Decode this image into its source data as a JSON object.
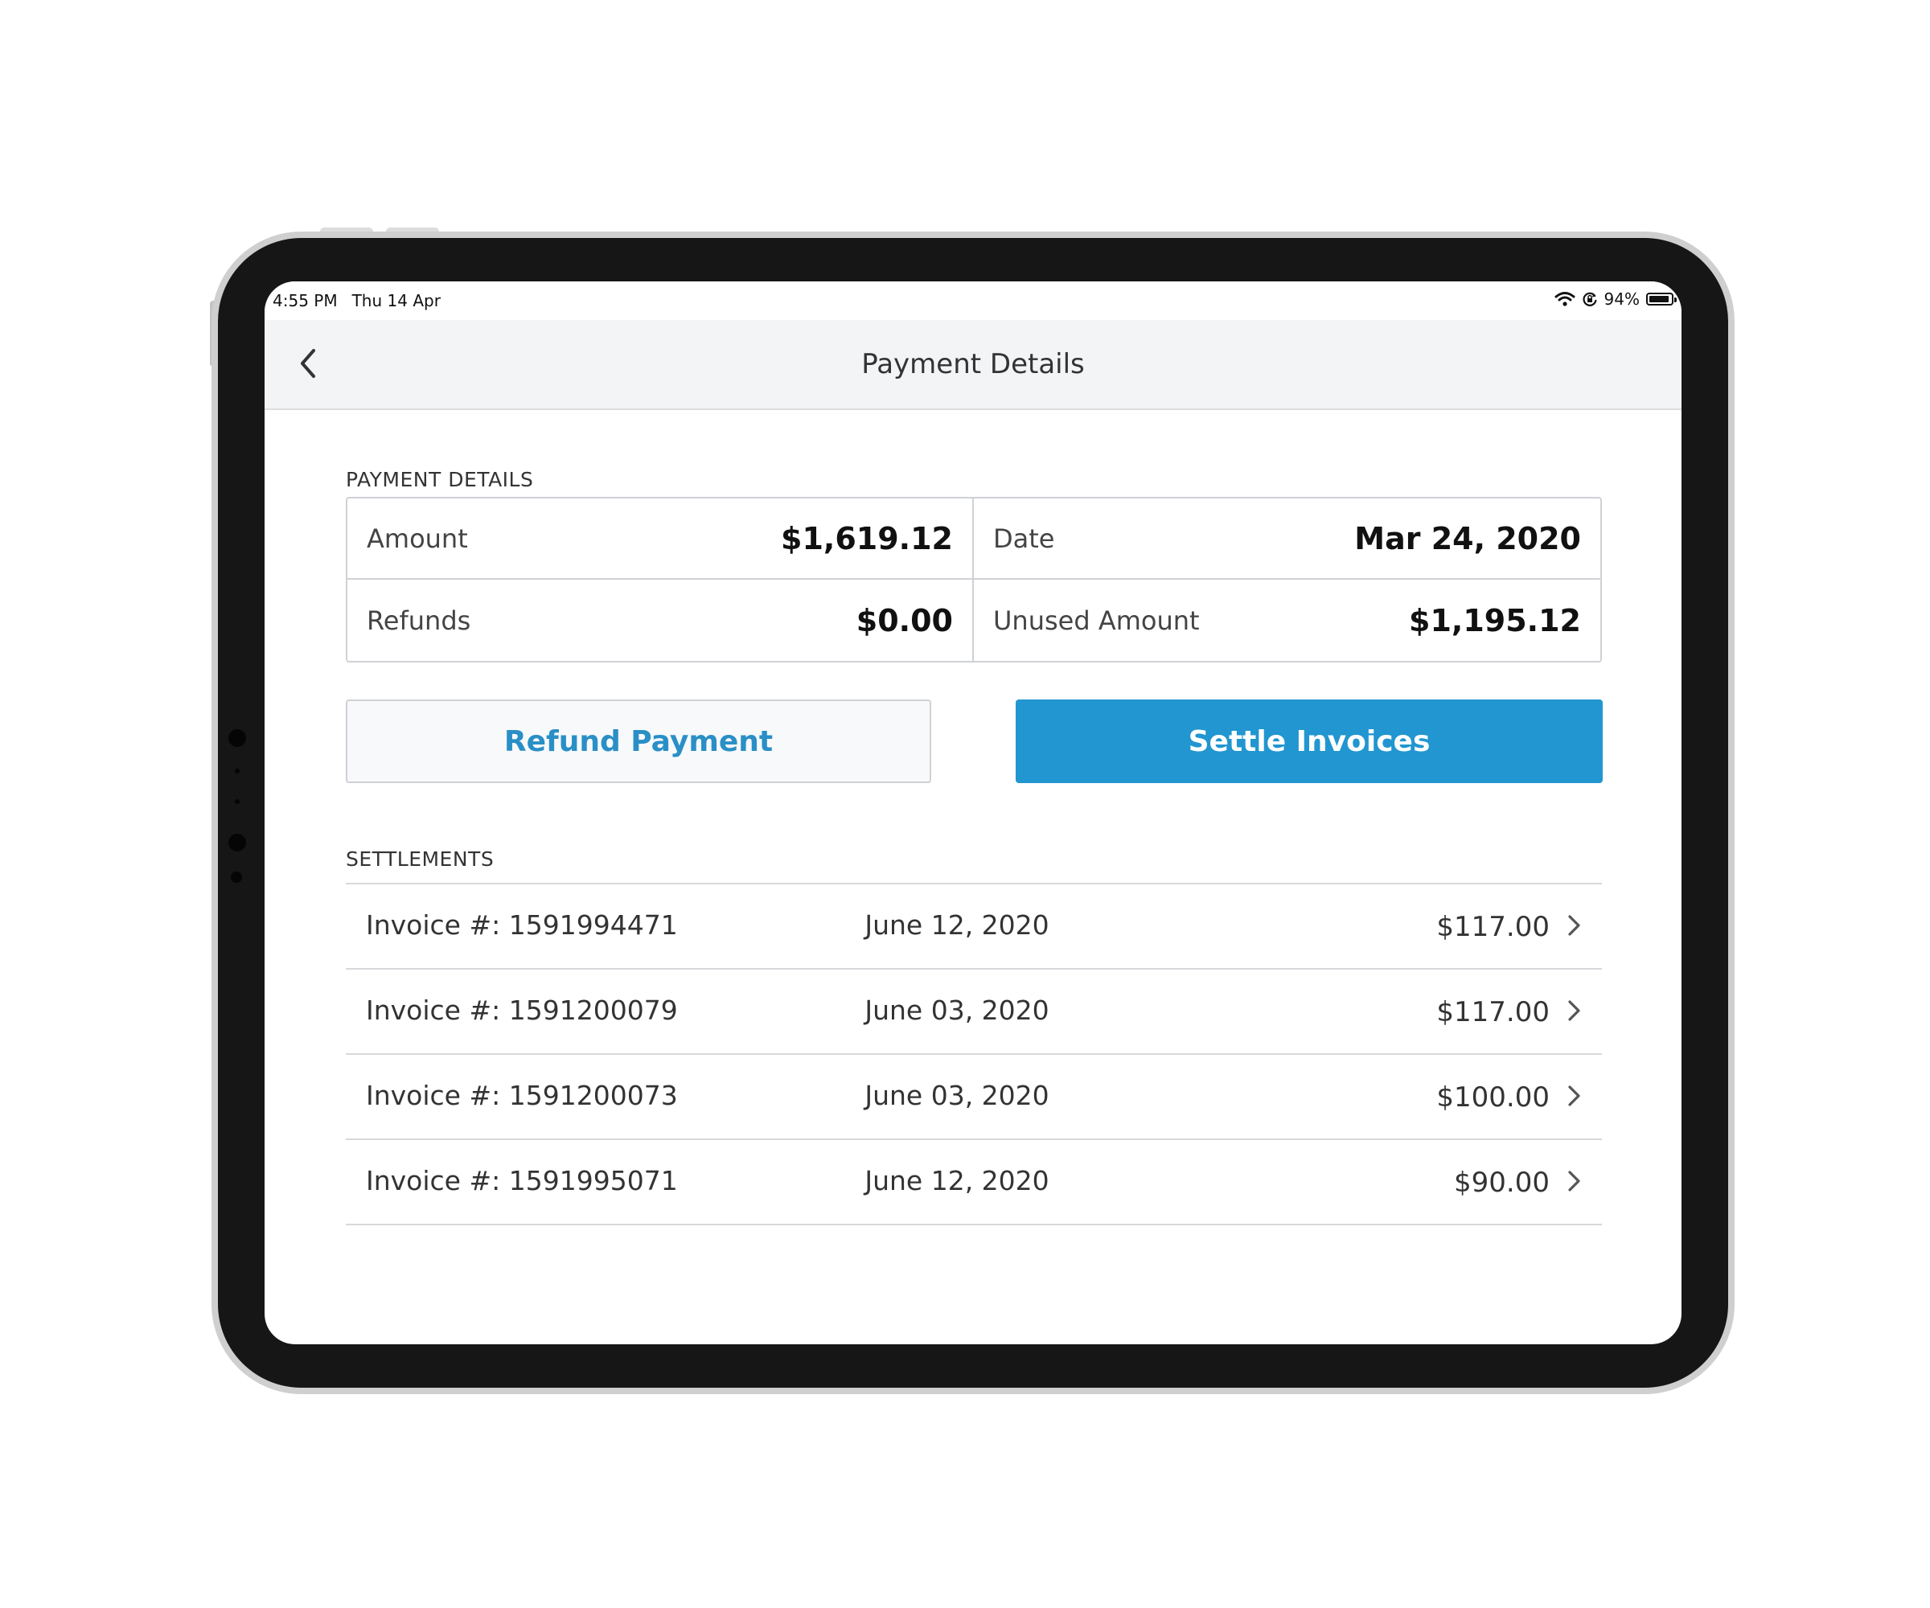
{
  "status_bar": {
    "time": "4:55 PM",
    "date": "Thu 14 Apr",
    "battery": "94%",
    "battery_level": 0.94,
    "icons": [
      "wifi-icon",
      "orientation-lock-icon",
      "battery-icon"
    ]
  },
  "nav": {
    "title": "Payment Details",
    "back_icon": "chevron-left-icon"
  },
  "payment_details": {
    "section_label": "PAYMENT DETAILS",
    "amount_label": "Amount",
    "amount_value": "$1,619.12",
    "date_label": "Date",
    "date_value": "Mar 24, 2020",
    "refunds_label": "Refunds",
    "refunds_value": "$0.00",
    "unused_label": "Unused Amount",
    "unused_value": "$1,195.12"
  },
  "actions": {
    "refund_label": "Refund Payment",
    "settle_label": "Settle Invoices"
  },
  "settlements": {
    "section_label": "SETTLEMENTS",
    "rows": [
      {
        "invoice": "Invoice #: 1591994471",
        "date": "June 12, 2020",
        "amount": "$117.00"
      },
      {
        "invoice": "Invoice #: 1591200079",
        "date": "June 03, 2020",
        "amount": "$117.00"
      },
      {
        "invoice": "Invoice #: 1591200073",
        "date": "June 03, 2020",
        "amount": "$100.00"
      },
      {
        "invoice": "Invoice #: 1591995071",
        "date": "June 12, 2020",
        "amount": "$90.00"
      }
    ]
  },
  "colors": {
    "primary": "#2196d0",
    "link": "#2a8fc6",
    "navbar_bg": "#f3f4f6"
  }
}
